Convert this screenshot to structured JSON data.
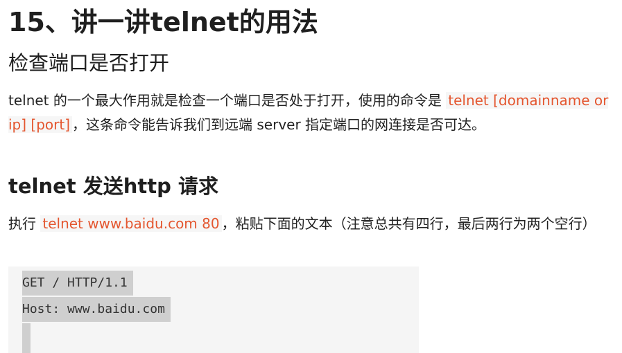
{
  "title": "15、讲一讲telnet的用法",
  "section1": {
    "heading": "检查端口是否打开",
    "text_before": "telnet 的一个最大作用就是检查一个端口是否处于打开，使用的命令是 ",
    "code": "telnet [domainname or ip] [port]",
    "text_after": "，这条命令能告诉我们到远端 server 指定端口的网连接是否可达。"
  },
  "section2": {
    "heading": "telnet 发送http 请求",
    "text_before": "执行 ",
    "code": "telnet www.baidu.com 80",
    "text_after": "，粘贴下面的文本（注意总共有四行，最后两行为两个空行）"
  },
  "code_block": {
    "lines": [
      "GET / HTTP/1.1",
      "Host: www.baidu.com"
    ]
  }
}
